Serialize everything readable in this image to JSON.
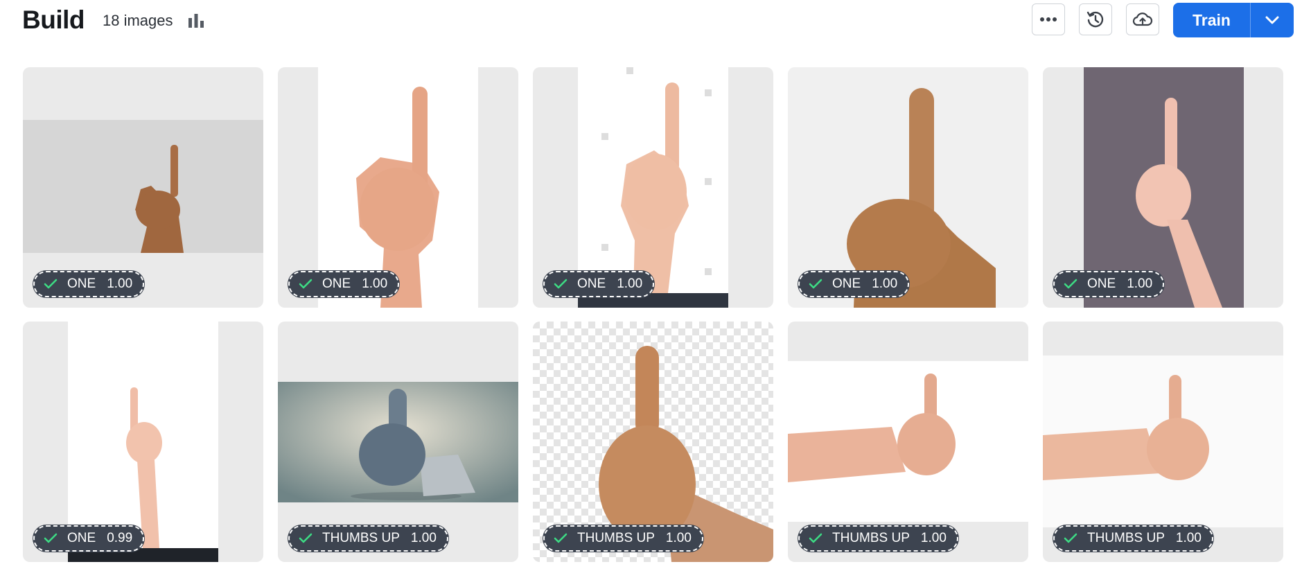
{
  "header": {
    "title": "Build",
    "image_count": "18 images",
    "stats_icon": "bar-chart-icon",
    "more_icon": "more-horizontal-icon",
    "history_icon": "history-icon",
    "upload_icon": "cloud-upload-icon",
    "train_label": "Train",
    "train_caret_icon": "chevron-down-icon"
  },
  "colors": {
    "accent": "#1c6fe8",
    "badge_bg": "#3d4450",
    "check": "#3ddc84",
    "card_bg": "#eaeaea"
  },
  "images": [
    {
      "label": "ONE",
      "score": "1.00"
    },
    {
      "label": "ONE",
      "score": "1.00"
    },
    {
      "label": "ONE",
      "score": "1.00"
    },
    {
      "label": "ONE",
      "score": "1.00"
    },
    {
      "label": "ONE",
      "score": "1.00"
    },
    {
      "label": "ONE",
      "score": "0.99"
    },
    {
      "label": "THUMBS UP",
      "score": "1.00"
    },
    {
      "label": "THUMBS UP",
      "score": "1.00"
    },
    {
      "label": "THUMBS UP",
      "score": "1.00"
    },
    {
      "label": "THUMBS UP",
      "score": "1.00"
    }
  ]
}
